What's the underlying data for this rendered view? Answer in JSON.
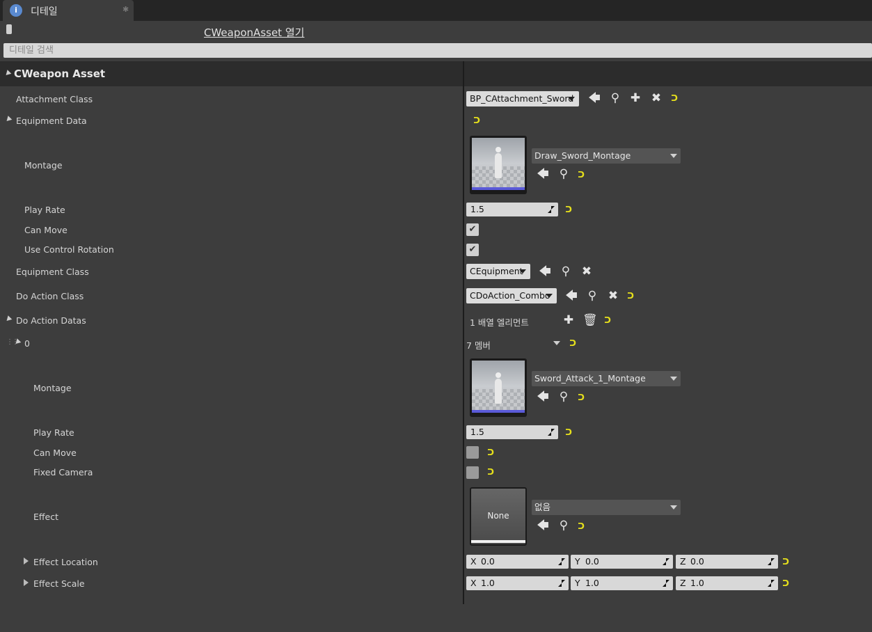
{
  "tab": {
    "icon": "info-icon",
    "icon_glyph": "i",
    "label": "디테일",
    "close_glyph": "✱"
  },
  "header": {
    "lock_icon": "lock-icon",
    "asset_link": "CWeaponAsset 열기"
  },
  "search": {
    "placeholder": "디테일 검색",
    "value": ""
  },
  "category": {
    "title": "CWeapon Asset"
  },
  "glyphs": {
    "back": "🡄",
    "browse": "⚲",
    "add": "✚",
    "clear": "✖",
    "trash": "🗑",
    "reset": "ᑐ",
    "check": "✔"
  },
  "attachment_class": {
    "label": "Attachment Class",
    "value": "BP_CAttachment_Sword"
  },
  "equipment_data": {
    "label": "Equipment Data",
    "montage": {
      "label": "Montage",
      "value": "Draw_Sword_Montage"
    },
    "play_rate": {
      "label": "Play Rate",
      "value": "1.5"
    },
    "can_move": {
      "label": "Can Move",
      "checked": true
    },
    "use_control_rotation": {
      "label": "Use Control Rotation",
      "checked": true
    }
  },
  "equipment_class": {
    "label": "Equipment Class",
    "value": "CEquipment"
  },
  "do_action_class": {
    "label": "Do Action Class",
    "value": "CDoAction_Combo"
  },
  "do_action_datas": {
    "label": "Do Action Datas",
    "count_text": "1 배열 엘리먼트",
    "item": {
      "index": "0",
      "members_text": "7 멤버",
      "montage": {
        "label": "Montage",
        "value": "Sword_Attack_1_Montage"
      },
      "play_rate": {
        "label": "Play Rate",
        "value": "1.5"
      },
      "can_move": {
        "label": "Can Move",
        "checked": false
      },
      "fixed_camera": {
        "label": "Fixed Camera",
        "checked": false
      },
      "effect": {
        "label": "Effect",
        "value": "없음",
        "thumb_text": "None"
      },
      "effect_location": {
        "label": "Effect Location",
        "x": "0.0",
        "y": "0.0",
        "z": "0.0"
      },
      "effect_scale": {
        "label": "Effect Scale",
        "x": "1.0",
        "y": "1.0",
        "z": "1.0"
      }
    }
  },
  "axis_labels": {
    "x": "X",
    "y": "Y",
    "z": "Z"
  }
}
